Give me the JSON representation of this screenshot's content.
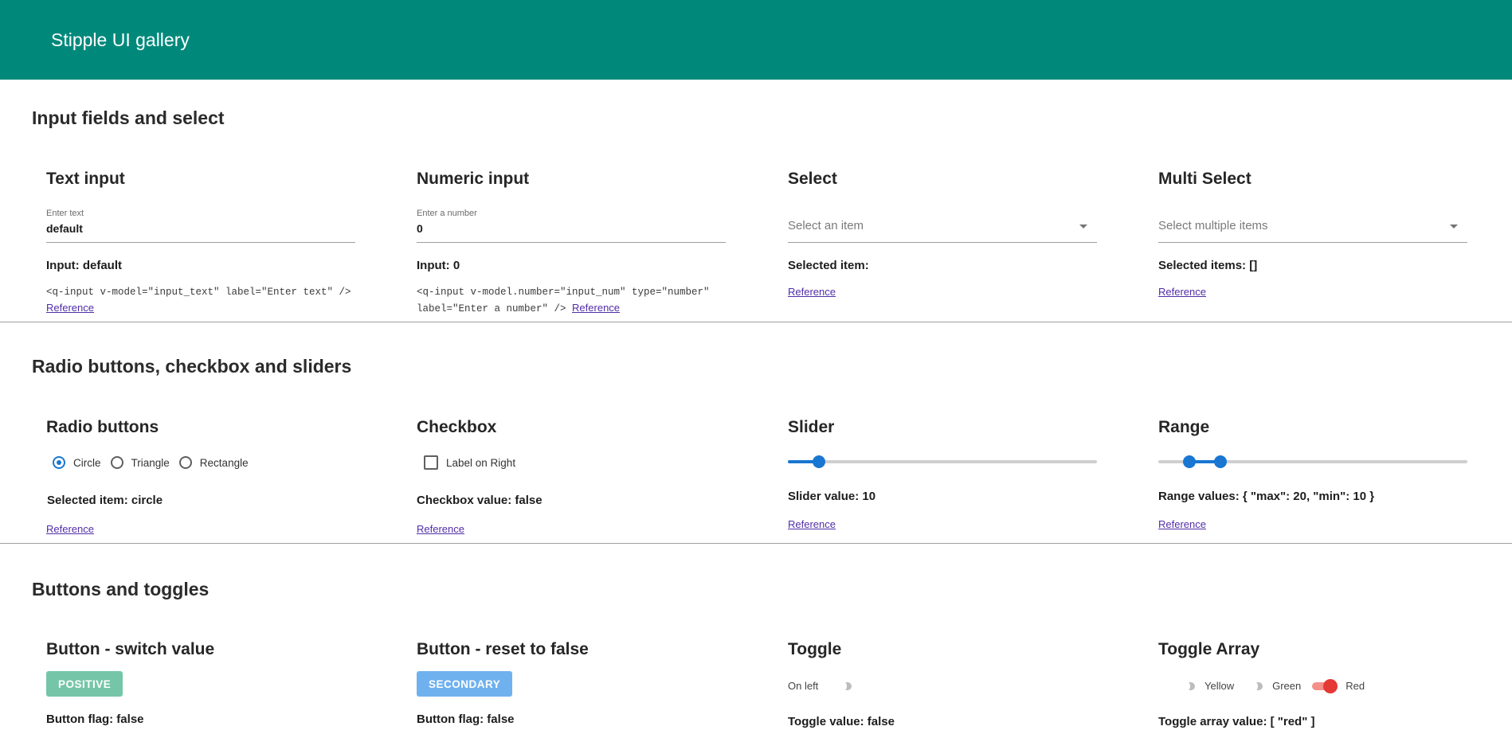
{
  "header": {
    "title": "Stipple UI gallery"
  },
  "sections": {
    "inputs": {
      "title": "Input fields and select",
      "text_input": {
        "title": "Text input",
        "label": "Enter text",
        "value": "default",
        "status": "Input: default",
        "code": "<q-input v-model=\"input_text\" label=\"Enter text\" />",
        "link": "Reference"
      },
      "numeric_input": {
        "title": "Numeric input",
        "label": "Enter a number",
        "value": "0",
        "status": "Input: 0",
        "code": "<q-input v-model.number=\"input_num\" type=\"number\" label=\"Enter a number\" />",
        "link": "Reference"
      },
      "select": {
        "title": "Select",
        "placeholder": "Select an item",
        "status": "Selected item:",
        "link": "Reference"
      },
      "multi_select": {
        "title": "Multi Select",
        "placeholder": "Select multiple items",
        "status": "Selected items: []",
        "link": "Reference"
      }
    },
    "radio": {
      "title": "Radio buttons, checkbox and sliders",
      "radio_buttons": {
        "title": "Radio buttons",
        "options": [
          "Circle",
          "Triangle",
          "Rectangle"
        ],
        "selected": "Circle",
        "status": "Selected item: circle",
        "link": "Reference"
      },
      "checkbox": {
        "title": "Checkbox",
        "label": "Label on Right",
        "checked": false,
        "status": "Checkbox value: false",
        "link": "Reference"
      },
      "slider": {
        "title": "Slider",
        "min": 0,
        "max": 100,
        "value": 10,
        "status": "Slider value: 10",
        "link": "Reference"
      },
      "range": {
        "title": "Range",
        "min": 0,
        "max": 100,
        "value_min": 10,
        "value_max": 20,
        "status": "Range values: { \"max\": 20, \"min\": 10 }",
        "link": "Reference"
      }
    },
    "buttons": {
      "title": "Buttons and toggles",
      "switch_button": {
        "title": "Button - switch value",
        "label": "POSITIVE",
        "status": "Button flag: false"
      },
      "reset_button": {
        "title": "Button - reset to false",
        "label": "SECONDARY",
        "status": "Button flag: false"
      },
      "toggle": {
        "title": "Toggle",
        "label": "On left",
        "on": false,
        "status": "Toggle value: false"
      },
      "toggle_array": {
        "title": "Toggle Array",
        "items": [
          {
            "label": "Yellow",
            "on": false
          },
          {
            "label": "Green",
            "on": false
          },
          {
            "label": "Red",
            "on": true
          }
        ],
        "status": "Toggle array value: [ \"red\" ]"
      }
    }
  },
  "colors": {
    "header": "#00897b",
    "accent": "#1976d2",
    "positive": "#75c6a8",
    "secondary": "#6fb1ee",
    "toggle_on": "#e53935",
    "link": "#512da8"
  }
}
